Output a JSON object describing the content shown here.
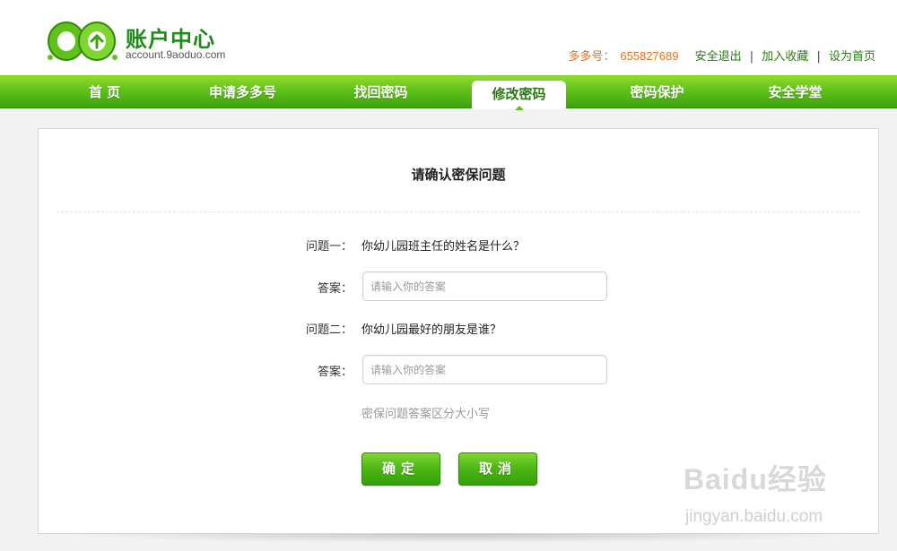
{
  "header": {
    "logo_title": "账户中心",
    "logo_domain": "account.9aoduo.com",
    "account_label": "多多号：",
    "account_number": "655827689",
    "links": [
      "安全退出",
      "加入收藏",
      "设为首页"
    ],
    "separators": [
      "|",
      "|"
    ]
  },
  "nav": {
    "items": [
      "首 页",
      "申请多多号",
      "找回密码",
      "修改密码",
      "密码保护",
      "安全学堂"
    ],
    "active": "修改密码"
  },
  "panel": {
    "title": "请确认密保问题",
    "question1_label": "问题一：",
    "question1_text": "你幼儿园班主任的姓名是什么？",
    "answer1_label": "答案：",
    "answer1_placeholder": "请输入你的答案",
    "answer1_value": "",
    "question2_label": "问题二：",
    "question2_text": "你幼儿园最好的朋友是谁？",
    "answer2_label": "答案：",
    "answer2_placeholder": "请输入你的答案",
    "answer2_value": "",
    "hint": "密保问题答案区分大小写",
    "confirm_label": "确定",
    "cancel_label": "取消"
  },
  "watermark": {
    "text": "Baidu经验",
    "url": "jingyan.baidu.com"
  },
  "colors": {
    "brand_green": "#4cb614",
    "logo_green": "#1f8a1a",
    "account_orange": "#e8711c",
    "link_green": "#2a7d12"
  }
}
